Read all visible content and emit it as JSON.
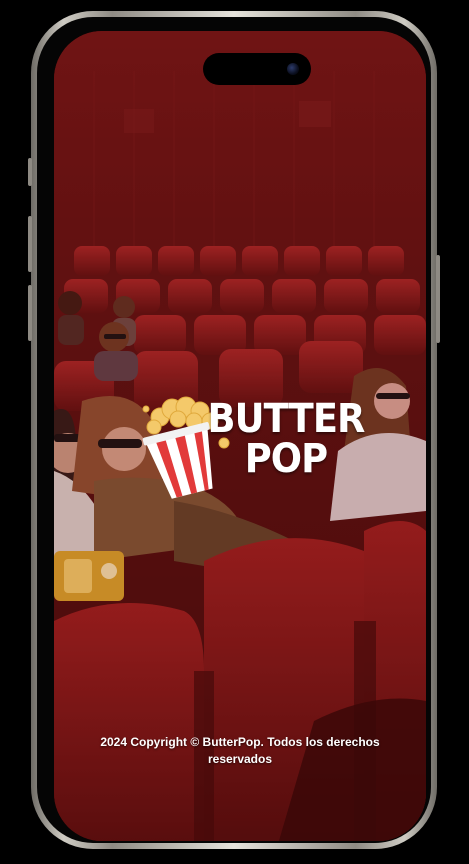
{
  "app": {
    "brand_line1": "BUTTER",
    "brand_line2": "POP",
    "copyright": "2024 Copyright © ButterPop. Todos los derechos reservados"
  },
  "icons": {
    "logo": "popcorn-icon",
    "camera": "front-camera-icon"
  },
  "colors": {
    "overlay_red": "#7a1414",
    "seat_red": "#8e1c1c",
    "popcorn_stripe": "#e23a3a",
    "popcorn_kernel": "#f4c96a",
    "text": "#ffffff"
  }
}
